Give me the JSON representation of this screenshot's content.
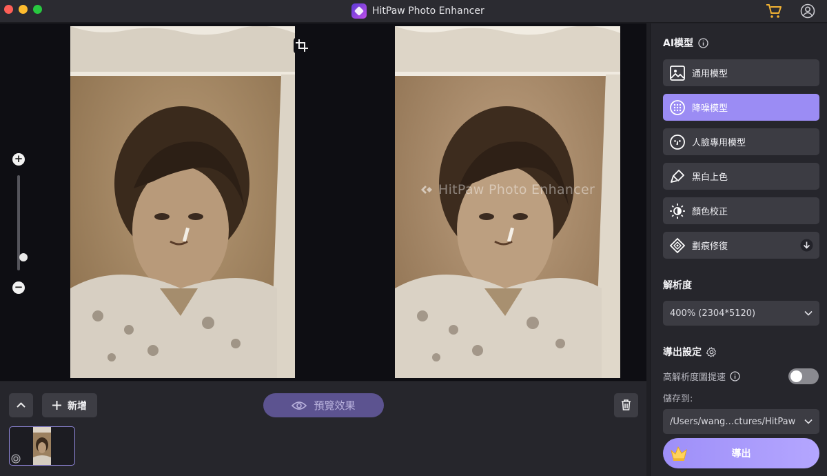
{
  "window": {
    "title": "HitPaw Photo Enhancer"
  },
  "canvas": {
    "watermark": "HitPaw Photo Enhancer",
    "zoom_level": 0.1
  },
  "bottom_bar": {
    "add_label": "新增",
    "preview_label": "預覽效果"
  },
  "sidebar": {
    "ai_model_title": "AI模型",
    "models": [
      {
        "label": "通用模型",
        "icon": "image-icon",
        "active": false
      },
      {
        "label": "降噪模型",
        "icon": "denoise-icon",
        "active": true
      },
      {
        "label": "人臉專用模型",
        "icon": "face-icon",
        "active": false
      },
      {
        "label": "黑白上色",
        "icon": "brush-icon",
        "active": false
      },
      {
        "label": "顏色校正",
        "icon": "sun-icon",
        "active": false
      },
      {
        "label": "劃痕修復",
        "icon": "patch-icon",
        "active": false,
        "download": true
      }
    ],
    "resolution_title": "解析度",
    "resolution_value": "400% (2304*5120)",
    "export_settings_title": "導出設定",
    "hires_label": "高解析度圖提速",
    "hires_enabled": false,
    "save_to_label": "儲存到:",
    "save_path": "/Users/wang…ctures/HitPaw",
    "export_label": "導出"
  },
  "colors": {
    "accent": "#9b8cf4",
    "panel": "#26262c",
    "canvas": "#0e0e13"
  }
}
